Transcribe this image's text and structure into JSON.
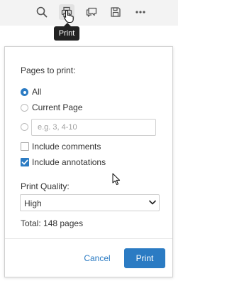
{
  "toolbar": {
    "buttons": [
      {
        "icon": "search-icon"
      },
      {
        "icon": "printer-icon",
        "state": "hovered"
      },
      {
        "icon": "comment-icon"
      },
      {
        "icon": "save-icon"
      },
      {
        "icon": "more-icon"
      }
    ],
    "tooltip": "Print"
  },
  "dialog": {
    "pages_label": "Pages to print:",
    "options": {
      "all": "All",
      "current_page": "Current Page",
      "range_placeholder": "e.g. 3, 4-10",
      "range_value": ""
    },
    "selected_pages_option": "All",
    "checkboxes": {
      "include_comments": {
        "label": "Include comments",
        "checked": false
      },
      "include_annotations": {
        "label": "Include annotations",
        "checked": true
      }
    },
    "quality_label": "Print Quality:",
    "quality_value": "High",
    "total": "Total: 148 pages",
    "cancel_label": "Cancel",
    "print_label": "Print"
  },
  "colors": {
    "accent": "#2b7bc3",
    "toolbar_bg": "#f3f3f3",
    "tooltip_bg": "#222222"
  }
}
